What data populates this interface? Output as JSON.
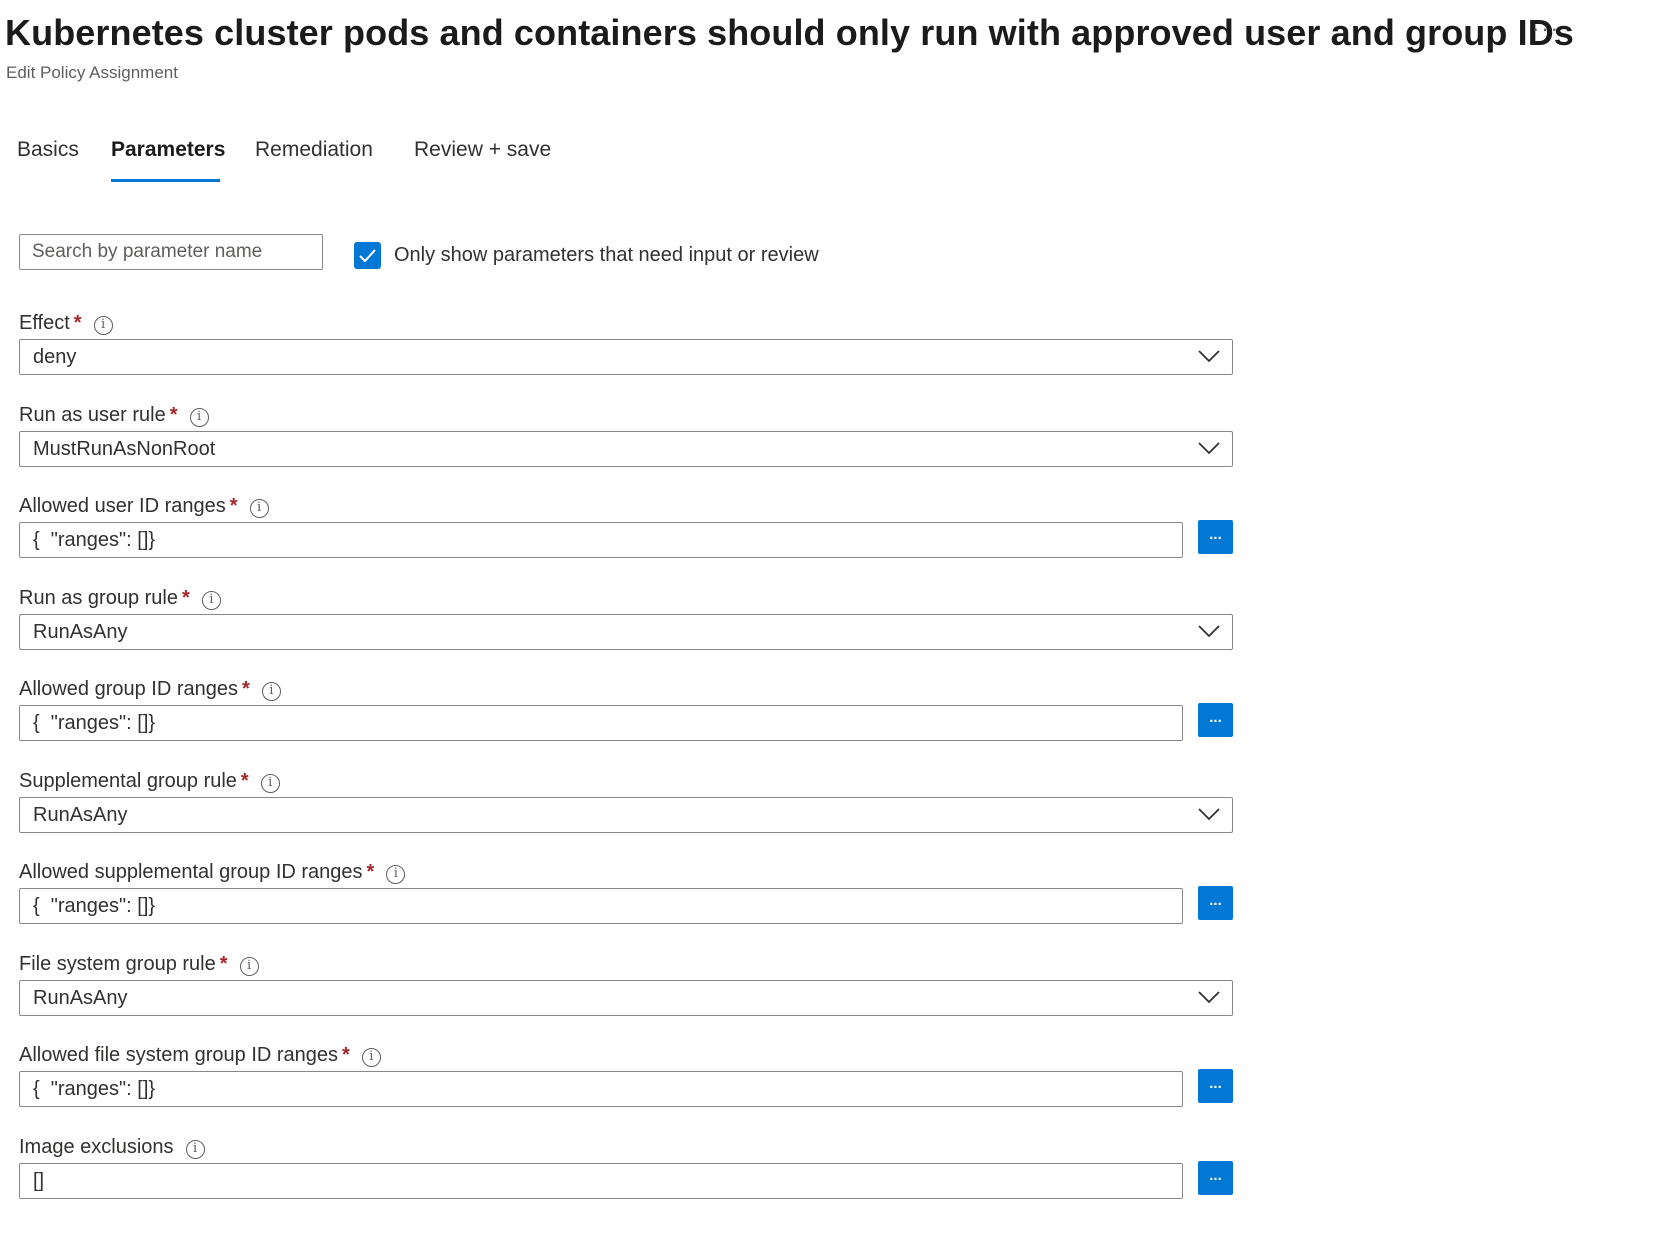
{
  "header": {
    "title": "Kubernetes cluster pods and containers should only run with approved user and group IDs",
    "more_label": "···",
    "subtitle": "Edit Policy Assignment"
  },
  "tabs": [
    {
      "label": "Basics"
    },
    {
      "label": "Parameters",
      "active": true
    },
    {
      "label": "Remediation"
    },
    {
      "label": "Review + save"
    }
  ],
  "filter": {
    "search_placeholder": "Search by parameter name",
    "only_show_label": "Only show parameters that need input or review",
    "only_show_checked": true
  },
  "required_marker": "*",
  "info_glyph": "i",
  "ellipsis_label": "...",
  "fields": [
    {
      "label": "Effect",
      "required": true,
      "type": "dropdown",
      "value": "deny"
    },
    {
      "label": "Run as user rule",
      "required": true,
      "type": "dropdown",
      "value": "MustRunAsNonRoot"
    },
    {
      "label": "Allowed user ID ranges",
      "required": true,
      "type": "text",
      "value": "{  \"ranges\": []}"
    },
    {
      "label": "Run as group rule",
      "required": true,
      "type": "dropdown",
      "value": "RunAsAny"
    },
    {
      "label": "Allowed group ID ranges",
      "required": true,
      "type": "text",
      "value": "{  \"ranges\": []}"
    },
    {
      "label": "Supplemental group rule",
      "required": true,
      "type": "dropdown",
      "value": "RunAsAny"
    },
    {
      "label": "Allowed supplemental group ID ranges",
      "required": true,
      "type": "text",
      "value": "{  \"ranges\": []}"
    },
    {
      "label": "File system group rule",
      "required": true,
      "type": "dropdown",
      "value": "RunAsAny"
    },
    {
      "label": "Allowed file system group ID ranges",
      "required": true,
      "type": "text",
      "value": "{  \"ranges\": []}"
    },
    {
      "label": "Image exclusions",
      "required": false,
      "type": "text",
      "value": "[]"
    }
  ],
  "colors": {
    "accent": "#0078d4",
    "required": "#a4262c"
  }
}
